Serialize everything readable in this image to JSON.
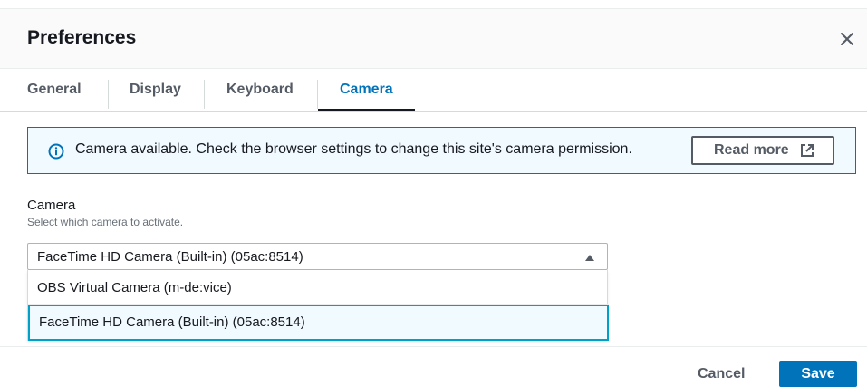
{
  "modal": {
    "title": "Preferences"
  },
  "tabs": [
    {
      "label": "General"
    },
    {
      "label": "Display"
    },
    {
      "label": "Keyboard"
    },
    {
      "label": "Camera"
    }
  ],
  "alert": {
    "text": "Camera available. Check the browser settings to change this site's camera permission.",
    "button_label": "Read more",
    "icon": "info-icon",
    "button_icon": "external-link-icon"
  },
  "field": {
    "label": "Camera",
    "description": "Select which camera to activate.",
    "selected": "FaceTime HD Camera (Built-in) (05ac:8514)",
    "options": [
      "OBS Virtual Camera (m-de:vice)",
      "FaceTime HD Camera (Built-in) (05ac:8514)"
    ]
  },
  "footer": {
    "cancel_label": "Cancel",
    "save_label": "Save"
  },
  "colors": {
    "accent": "#0073bb",
    "alert_border": "#0073bb",
    "alert_bg": "#f1faff",
    "option_focus_border": "#00a1c9"
  }
}
